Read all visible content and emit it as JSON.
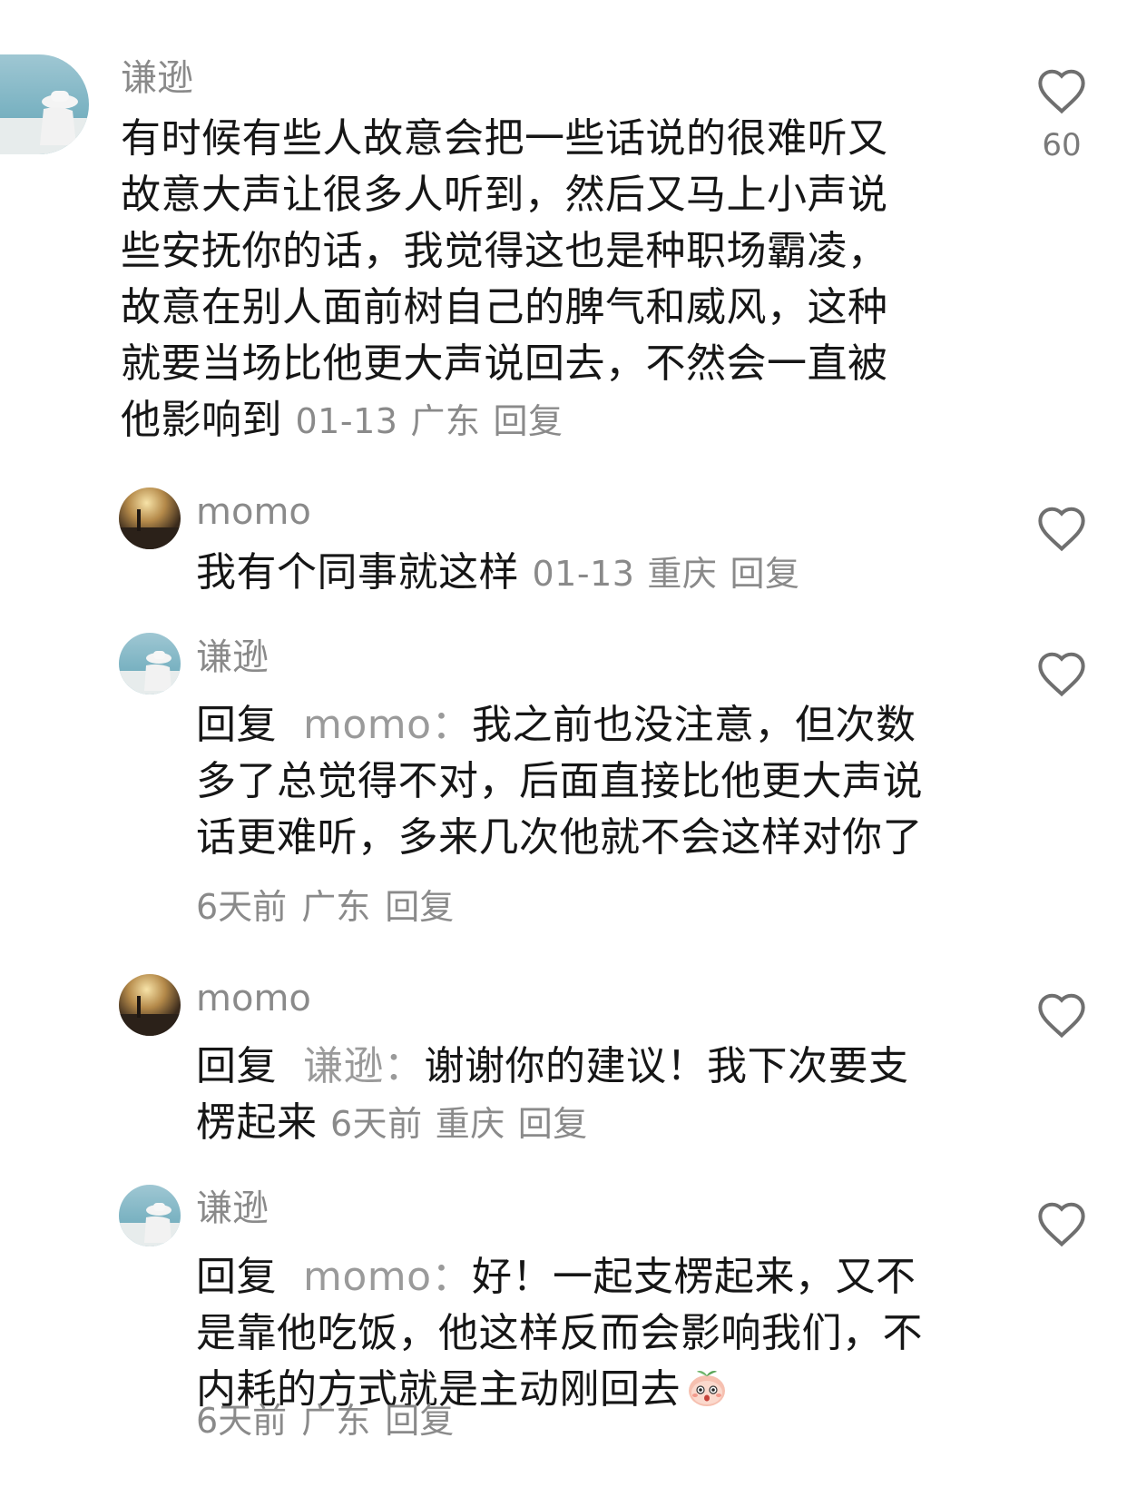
{
  "comments": [
    {
      "user": "谦逊",
      "lines": [
        "有时候有些人故意会把一些话说的很难听又",
        "故意大声让很多人听到，然后又马上小声说",
        "些安抚你的话，我觉得这也是种职场霸凌，",
        "故意在别人面前树自己的脾气和威风，这种",
        "就要当场比他更大声说回去，不然会一直被",
        "他影响到"
      ],
      "date": "01-13",
      "location": "广东",
      "reply_label": "回复",
      "likes": "60"
    },
    {
      "user": "momo",
      "text": "我有个同事就这样",
      "date": "01-13",
      "location": "重庆",
      "reply_label": "回复"
    },
    {
      "user": "谦逊",
      "prefix": "回复",
      "mention": "momo：",
      "lines": [
        "我之前也没注意，但次数",
        "多了总觉得不对，后面直接比他更大声说",
        "话更难听，多来几次他就不会这样对你了"
      ],
      "date": "6天前",
      "location": "广东",
      "reply_label": "回复"
    },
    {
      "user": "momo",
      "prefix": "回复",
      "mention": "谦逊：",
      "lines": [
        "谢谢你的建议！我下次要支",
        "楞起来"
      ],
      "date": "6天前",
      "location": "重庆",
      "reply_label": "回复"
    },
    {
      "user": "谦逊",
      "prefix": "回复",
      "mention": "momo：",
      "lines": [
        "好！一起支楞起来，又不",
        "是靠他吃饭，他这样反而会影响我们，不",
        "内耗的方式就是主动刚回去"
      ],
      "emoji": "peach-face-emoji",
      "date": "6天前",
      "location": "广东",
      "reply_label": "回复"
    }
  ],
  "colors": {
    "text": "#161616",
    "meta": "#8a8a8a",
    "heart": "#6f6f6f"
  }
}
